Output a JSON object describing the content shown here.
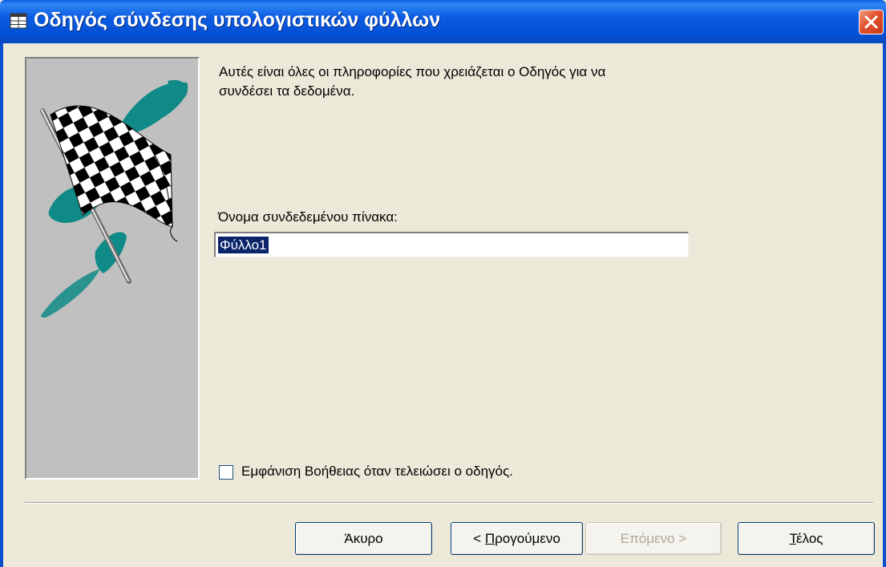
{
  "window": {
    "title": "Οδηγός σύνδεσης υπολογιστικών φύλλων"
  },
  "icons": {
    "title": "sheet-link-icon",
    "close": "close-icon",
    "wizard_art": "checkered-flag-icon"
  },
  "content": {
    "intro_line1": "Αυτές είναι όλες οι πληροφορίες που χρειάζεται ο Οδηγός για να",
    "intro_line2": "συνδέσει τα δεδομένα.",
    "table_name_label": "Όνομα συνδεδεμένου πίνακα:",
    "table_name_value": "Φύλλο1",
    "help_checkbox_label": "Εμφάνιση Βοήθειας όταν τελειώσει ο οδηγός.",
    "help_checkbox_checked": false
  },
  "buttons": {
    "cancel": "Άκυρο",
    "back_prefix": "< ",
    "back_mnemonic": "Π",
    "back_rest": "ρογούμενο",
    "next": "Επόμενο >",
    "finish_mnemonic": "Τ",
    "finish_rest": "έλος"
  },
  "colors": {
    "titlebar": "#0B5CE3",
    "dialog_bg": "#ECE9D8",
    "art_bg": "#C0C0C0",
    "teal": "#0F8A86",
    "selection": "#0A246A"
  }
}
